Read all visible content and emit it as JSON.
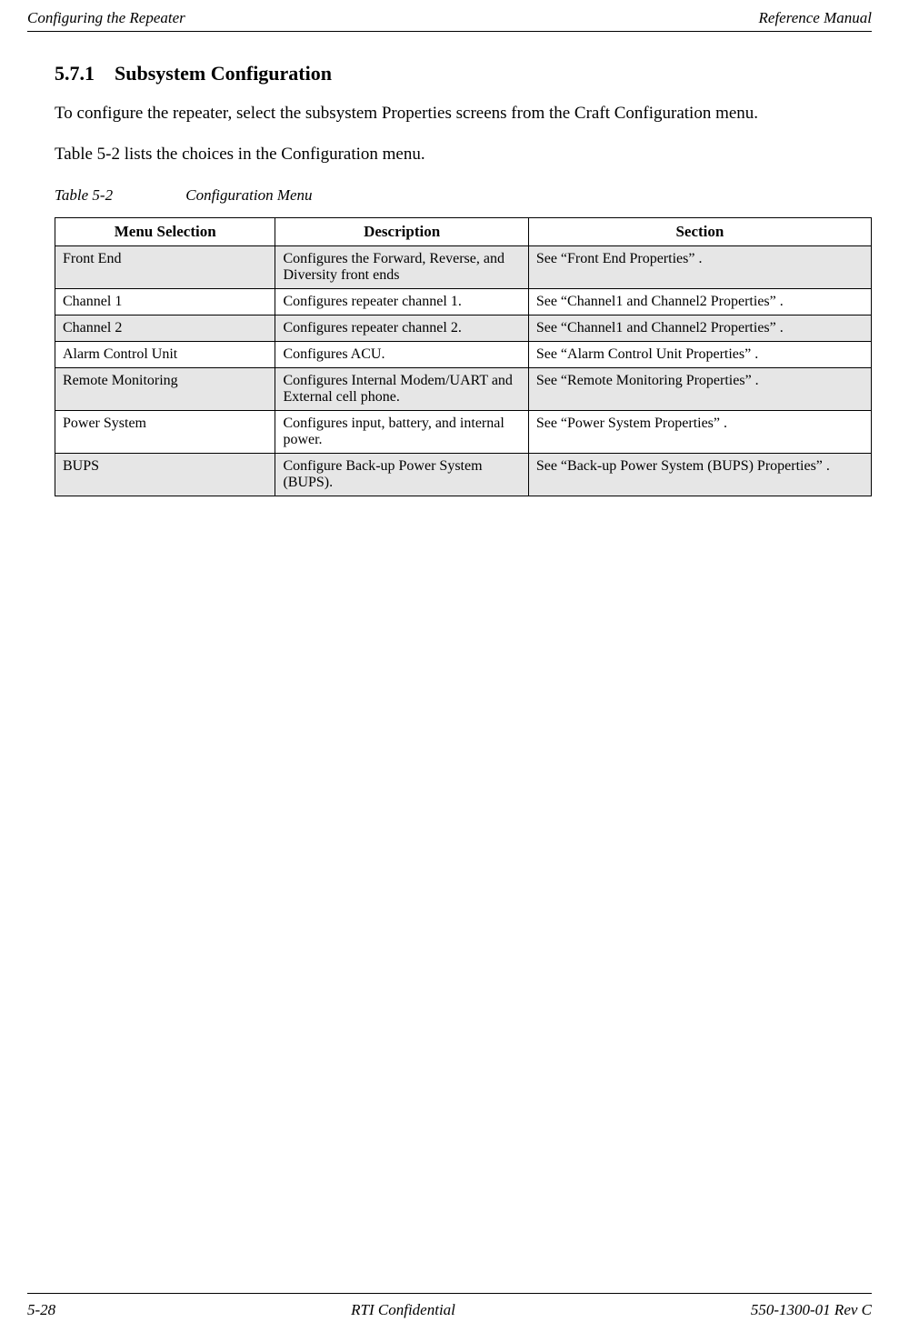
{
  "header": {
    "left": "Configuring the Repeater",
    "right": "Reference Manual"
  },
  "section": {
    "number": "5.7.1",
    "title": "Subsystem Configuration"
  },
  "paragraphs": {
    "p1": "To configure the repeater, select the subsystem Properties screens from the Craft Configuration menu.",
    "p2": "Table 5-2 lists the choices in the Configuration menu."
  },
  "table": {
    "caption_label": "Table 5-2",
    "caption_title": "Configuration Menu",
    "headers": {
      "h1": "Menu Selection",
      "h2": "Description",
      "h3": "Section"
    },
    "rows": [
      {
        "shaded": true,
        "menu": "Front End",
        "desc": "Configures the Forward, Reverse, and Diversity front ends",
        "section": "See “Front End Properties” ."
      },
      {
        "shaded": false,
        "menu": "Channel 1",
        "desc": "Configures repeater channel 1.",
        "section": "See “Channel1 and Channel2 Properties” ."
      },
      {
        "shaded": true,
        "menu": "Channel 2",
        "desc": "Configures repeater channel 2.",
        "section": "See “Channel1 and Channel2 Properties” ."
      },
      {
        "shaded": false,
        "menu": "Alarm Control Unit",
        "desc": "Configures ACU.",
        "section": "See “Alarm Control Unit Properties” ."
      },
      {
        "shaded": true,
        "menu": "Remote Monitoring",
        "desc": "Configures Internal Modem/UART and External cell phone.",
        "section": "See “Remote Monitoring Properties” ."
      },
      {
        "shaded": false,
        "menu": "Power System",
        "desc": "Configures input, battery, and internal power.",
        "section": "See “Power System Properties” ."
      },
      {
        "shaded": true,
        "menu": "BUPS",
        "desc": "Configure Back-up Power System (BUPS).",
        "section": "See “Back-up Power System (BUPS) Properties” ."
      }
    ]
  },
  "footer": {
    "left": "5-28",
    "center": "RTI Confidential",
    "right": "550-1300-01 Rev C"
  }
}
